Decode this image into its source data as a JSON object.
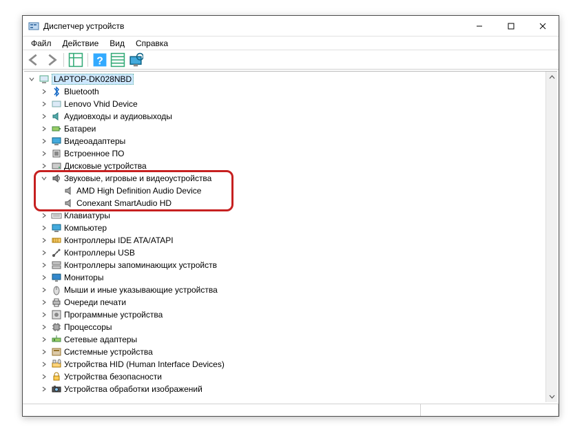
{
  "window": {
    "title": "Диспетчер устройств"
  },
  "menu": {
    "file": "Файл",
    "action": "Действие",
    "view": "Вид",
    "help": "Справка"
  },
  "tree": {
    "root": "LAPTOP-DK028NBD",
    "items": [
      {
        "label": "Bluetooth",
        "icon": "bluetooth"
      },
      {
        "label": "Lenovo Vhid Device",
        "icon": "generic"
      },
      {
        "label": "Аудиовходы и аудиовыходы",
        "icon": "audio-io"
      },
      {
        "label": "Батареи",
        "icon": "battery"
      },
      {
        "label": "Видеоадаптеры",
        "icon": "display"
      },
      {
        "label": "Встроенное ПО",
        "icon": "firmware"
      },
      {
        "label": "Дисковые устройства",
        "icon": "disk"
      },
      {
        "label": "Звуковые, игровые и видеоустройства",
        "icon": "sound",
        "expanded": true,
        "children": [
          "AMD High Definition Audio Device",
          "Conexant SmartAudio HD"
        ]
      },
      {
        "label": "Клавиатуры",
        "icon": "keyboard"
      },
      {
        "label": "Компьютер",
        "icon": "computer"
      },
      {
        "label": "Контроллеры IDE ATA/ATAPI",
        "icon": "ide"
      },
      {
        "label": "Контроллеры USB",
        "icon": "usb"
      },
      {
        "label": "Контроллеры запоминающих устройств",
        "icon": "storage"
      },
      {
        "label": "Мониторы",
        "icon": "monitor"
      },
      {
        "label": "Мыши и иные указывающие устройства",
        "icon": "mouse"
      },
      {
        "label": "Очереди печати",
        "icon": "printer"
      },
      {
        "label": "Программные устройства",
        "icon": "software"
      },
      {
        "label": "Процессоры",
        "icon": "cpu"
      },
      {
        "label": "Сетевые адаптеры",
        "icon": "network"
      },
      {
        "label": "Системные устройства",
        "icon": "system"
      },
      {
        "label": "Устройства HID (Human Interface Devices)",
        "icon": "hid"
      },
      {
        "label": "Устройства безопасности",
        "icon": "security"
      },
      {
        "label": "Устройства обработки изображений",
        "icon": "imaging"
      }
    ]
  }
}
